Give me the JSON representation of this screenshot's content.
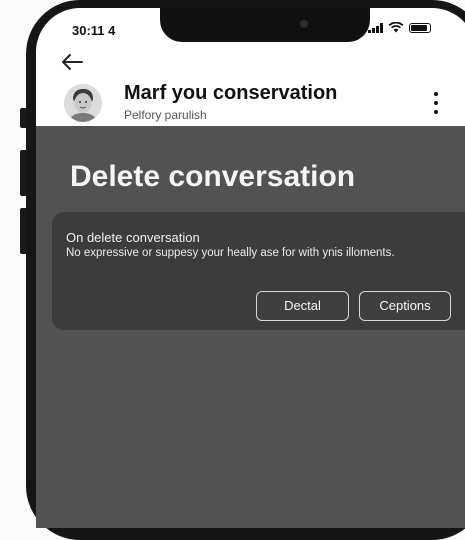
{
  "status_bar": {
    "time": "30:11 4"
  },
  "header": {
    "title": "Marf you conservation",
    "subtitle": "Pelfory parulish"
  },
  "main": {
    "heading": "Delete conversation"
  },
  "dialog": {
    "title": "On delete conversation",
    "body": "No expressive or suppesy your heally ase for with ynis illoments.",
    "delete_label": "Dectal",
    "options_label": "Ceptions"
  },
  "colors": {
    "content_bg": "#525252",
    "dialog_bg": "#3c3c3c",
    "topbar_bg": "#ffffff",
    "frame": "#161616"
  },
  "icons": [
    "back-arrow-icon",
    "more-vertical-icon",
    "signal-icon",
    "wifi-icon",
    "battery-icon"
  ]
}
